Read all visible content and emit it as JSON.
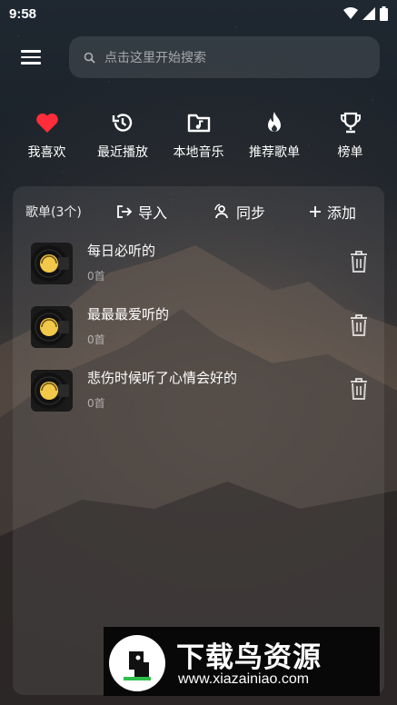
{
  "status_bar": {
    "time": "9:58",
    "icons": [
      "wifi-icon",
      "cell-signal-icon",
      "battery-icon"
    ]
  },
  "header": {
    "menu_icon": "hamburger-menu-icon",
    "search": {
      "icon": "search-icon",
      "placeholder": "点击这里开始搜索"
    }
  },
  "quick_nav": [
    {
      "label": "我喜欢",
      "icon": "heart-icon",
      "color": "#ff2d3a"
    },
    {
      "label": "最近播放",
      "icon": "history-icon"
    },
    {
      "label": "本地音乐",
      "icon": "music-folder-icon"
    },
    {
      "label": "推荐歌单",
      "icon": "flame-icon"
    },
    {
      "label": "榜单",
      "icon": "trophy-icon"
    }
  ],
  "playlists_panel": {
    "title": "歌单(3个)",
    "actions": {
      "import_label": "导入",
      "sync_label": "同步",
      "add_label": "添加"
    },
    "items": [
      {
        "name": "每日必听的",
        "count": "0首"
      },
      {
        "name": "最最最爱听的",
        "count": "0首"
      },
      {
        "name": "悲伤时候听了心情会好的",
        "count": "0首"
      }
    ]
  },
  "watermark": {
    "title": "下载鸟资源",
    "url": "www.xiazainiao.com"
  }
}
